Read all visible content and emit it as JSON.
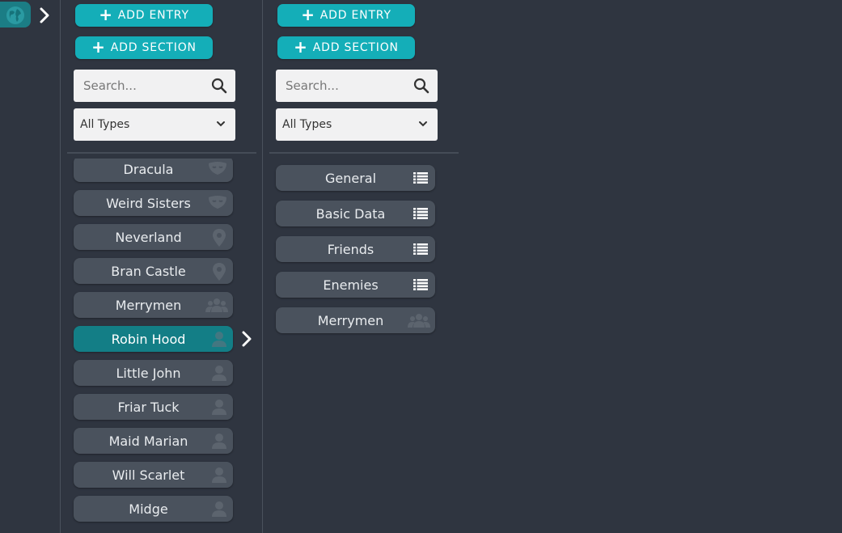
{
  "left_panel": {
    "add_entry_label": "ADD ENTRY",
    "add_section_label": "ADD SECTION",
    "search_placeholder": "Search...",
    "type_filter": "All Types",
    "entries": [
      {
        "label": "Dracula",
        "icon": "mask-icon"
      },
      {
        "label": "Weird Sisters",
        "icon": "mask-icon"
      },
      {
        "label": "Neverland",
        "icon": "location-pin-icon"
      },
      {
        "label": "Bran Castle",
        "icon": "location-pin-icon"
      },
      {
        "label": "Merrymen",
        "icon": "group-icon"
      },
      {
        "label": "Robin Hood",
        "icon": "person-icon",
        "selected": true
      },
      {
        "label": "Little John",
        "icon": "person-icon"
      },
      {
        "label": "Friar Tuck",
        "icon": "person-icon"
      },
      {
        "label": "Maid Marian",
        "icon": "person-icon"
      },
      {
        "label": "Will Scarlet",
        "icon": "person-icon"
      },
      {
        "label": "Midge",
        "icon": "person-icon"
      }
    ]
  },
  "right_panel": {
    "add_entry_label": "ADD ENTRY",
    "add_section_label": "ADD SECTION",
    "search_placeholder": "Search...",
    "type_filter": "All Types",
    "sections": [
      {
        "label": "General",
        "icon": "list-icon"
      },
      {
        "label": "Basic Data",
        "icon": "list-icon"
      },
      {
        "label": "Friends",
        "icon": "list-icon"
      },
      {
        "label": "Enemies",
        "icon": "list-icon"
      },
      {
        "label": "Merrymen",
        "icon": "group-icon"
      }
    ]
  },
  "colors": {
    "background": "#2f3540",
    "accent": "#14aeb8",
    "selected": "#137e86",
    "item": "#4a525d"
  }
}
